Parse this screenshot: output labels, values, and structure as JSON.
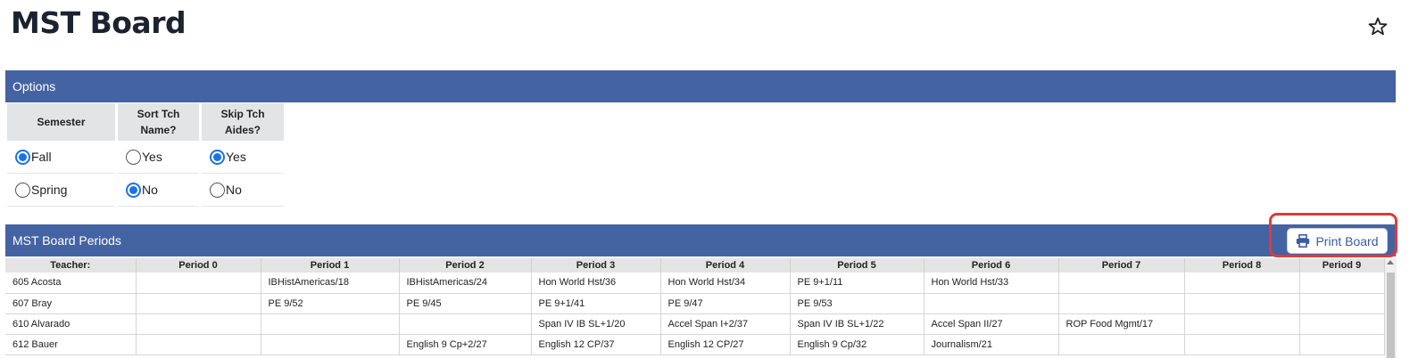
{
  "page": {
    "title": "MST Board"
  },
  "options": {
    "header": "Options",
    "semester": {
      "label": "Semester",
      "choices": [
        "Fall",
        "Spring"
      ],
      "selected": "Fall"
    },
    "sort_tch_name": {
      "label_line1": "Sort Tch",
      "label_line2": "Name?",
      "choices": [
        "Yes",
        "No"
      ],
      "selected": "No"
    },
    "skip_tch_aides": {
      "label_line1": "Skip Tch",
      "label_line2": "Aides?",
      "choices": [
        "Yes",
        "No"
      ],
      "selected": "Yes"
    }
  },
  "periods": {
    "header": "MST Board Periods",
    "print_label": "Print Board",
    "columns": [
      "Teacher:",
      "Period 0",
      "Period 1",
      "Period 2",
      "Period 3",
      "Period 4",
      "Period 5",
      "Period 6",
      "Period 7",
      "Period 8",
      "Period 9"
    ],
    "rows": [
      [
        "605 Acosta",
        "",
        "IBHistAmericas/18",
        "IBHistAmericas/24",
        "Hon World Hst/36",
        "Hon World Hst/34",
        "PE 9+1/11",
        "Hon World Hst/33",
        "",
        "",
        ""
      ],
      [
        "607 Bray",
        "",
        "PE 9/52",
        "PE 9/45",
        "PE 9+1/41",
        "PE 9/47",
        "PE 9/53",
        "",
        "",
        "",
        ""
      ],
      [
        "610 Alvarado",
        "",
        "",
        "",
        "Span IV IB SL+1/20",
        "Accel Span I+2/37",
        "Span IV IB SL+1/22",
        "Accel Span II/27",
        "ROP Food Mgmt/17",
        "",
        ""
      ],
      [
        "612 Bauer",
        "",
        "",
        "English 9 Cp+2/27",
        "English 12 CP/37",
        "English 12 CP/27",
        "English 9 Cp/32",
        "Journalism/21",
        "",
        "",
        ""
      ]
    ]
  },
  "colors": {
    "header_bg": "#4463a3",
    "radio_checked": "#1a73e8",
    "highlight": "#e03a3a"
  },
  "icons": {
    "favorite": "star-icon",
    "print": "printer-icon"
  }
}
